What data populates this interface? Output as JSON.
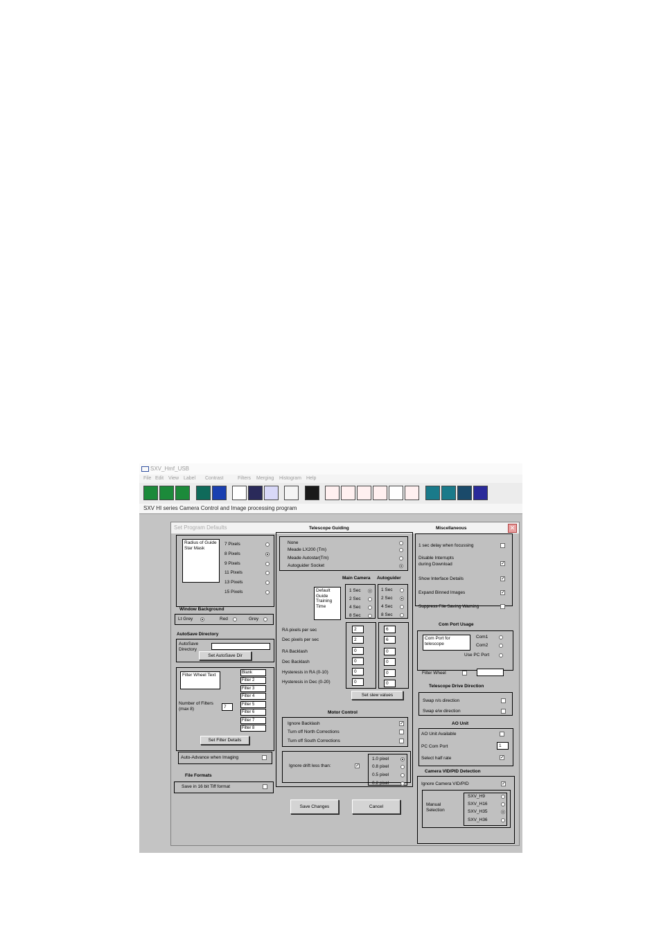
{
  "window": {
    "title": "SXV_Hmf_USB"
  },
  "menu": [
    "File",
    "Edit",
    "View",
    "Label",
    "Contrast",
    "Filters",
    "Merging",
    "Histogram",
    "Help"
  ],
  "status_line": "SXV HI series Camera Control and Image processing program",
  "dialog": {
    "title": "Set Program Defaults",
    "close_glyph": "✕",
    "mask": {
      "label": "Radius of Guide Star Mask",
      "options": [
        "7 Pixels",
        "8 Pixels",
        "9 Pixels",
        "11 Pixels",
        "13 Pixels",
        "15 Pixels"
      ],
      "selected": "8 Pixels"
    },
    "window_background": {
      "title": "Window Background",
      "options": [
        "Lt Grey",
        "Red",
        "Grey"
      ],
      "selected": "Lt Grey"
    },
    "autosave": {
      "title": "AutoSave Directory",
      "label": "AutoSave Directory",
      "value": "",
      "button": "Set AutoSave Dir"
    },
    "filter_wheel": {
      "label": "Filter Wheel Text",
      "filters": [
        "Blank",
        "Filter 2",
        "Filter 3",
        "Filter 4",
        "Filter 5",
        "Filter 6",
        "Filter 7",
        "Filter 8"
      ],
      "count_label": "Number of Filters (max 8)",
      "count": "7",
      "button": "Set Filter Details",
      "auto_advance": "Auto-Advance when Imaging"
    },
    "file_formats": {
      "title": "File Formats",
      "tiff16": "Save in 16 bit Tiff format"
    },
    "telescope_guiding": {
      "title": "Telescope Guiding",
      "options": [
        "None",
        "Meade LX200 (Tm)",
        "Meade Autostar(Tm)",
        "Autoguider Socket"
      ],
      "selected": "Autoguider Socket"
    },
    "training": {
      "main_camera": "Main Camera",
      "autoguider": "Autoguider",
      "label": "Default Guide Training Time",
      "times": [
        "1 Sec",
        "2 Sec",
        "4 Sec",
        "8 Sec"
      ],
      "main_selected": "1 Sec",
      "auto_selected": "2 Sec"
    },
    "slew": {
      "rows": [
        {
          "label": "RA pixels per sec",
          "main": "2",
          "auto": "6"
        },
        {
          "label": "Dec pixels per sec",
          "main": "2",
          "auto": "6"
        },
        {
          "label": "RA Backlash",
          "main": "0",
          "auto": "0"
        },
        {
          "label": "Dec Backlash",
          "main": "0",
          "auto": "0"
        },
        {
          "label": "Hysteresis in RA (0-10)",
          "main": "0",
          "auto": "0"
        },
        {
          "label": "Hysteresis in Dec (0-20)",
          "main": "0",
          "auto": "0"
        }
      ],
      "button": "Set slew values"
    },
    "motor_control": {
      "title": "Motor Control",
      "items": [
        {
          "label": "Ignore Backlash",
          "checked": true
        },
        {
          "label": "Turn off North Corrections",
          "checked": false
        },
        {
          "label": "Turn off South Corrections",
          "checked": false
        }
      ]
    },
    "drift": {
      "label": "Ignore drift less than:",
      "checked": true,
      "options": [
        "1.0 pixel",
        "0.8 pixel",
        "0.5 pixel",
        "0.2 pixel"
      ],
      "selected": "1.0 pixel"
    },
    "buttons": {
      "save": "Save Changes",
      "cancel": "Cancel"
    },
    "misc": {
      "title": "Miscellaneous",
      "items": [
        {
          "label": "1 sec delay when focussing",
          "checked": false
        },
        {
          "label": "Disable Interrupts during Download",
          "checked": true
        },
        {
          "label": "Show Interface Details",
          "checked": true
        },
        {
          "label": "Expand Binned Images",
          "checked": true
        },
        {
          "label": "Suppress File Saving Warning",
          "checked": false
        }
      ]
    },
    "com_port": {
      "title": "Com Port Usage",
      "label": "Com Port for telescope",
      "options": [
        "Com1",
        "Com2",
        "Use PC Port"
      ],
      "filter_wheel": "Filter Wheel",
      "filter_wheel_value": ""
    },
    "drive_direction": {
      "title": "Telescope Drive Direction",
      "items": [
        "Swap n/s direction",
        "Swap e/w direction"
      ]
    },
    "ao_unit": {
      "title": "AO Unit",
      "available": "AO Unit Available",
      "pc_com_port": "PC Com Port",
      "pc_com_value": "1",
      "half_rate": "Select half rate",
      "half_rate_checked": true
    },
    "vid_pid": {
      "title": "Camera VID/PID Detection",
      "ignore": "Ignore Camera VID/PID",
      "ignore_checked": true,
      "manual": "Manual Selection",
      "options": [
        "SXV_H9",
        "SXV_H16",
        "SXV_H35",
        "SXV_H36"
      ],
      "selected": "SXV_H35"
    }
  }
}
